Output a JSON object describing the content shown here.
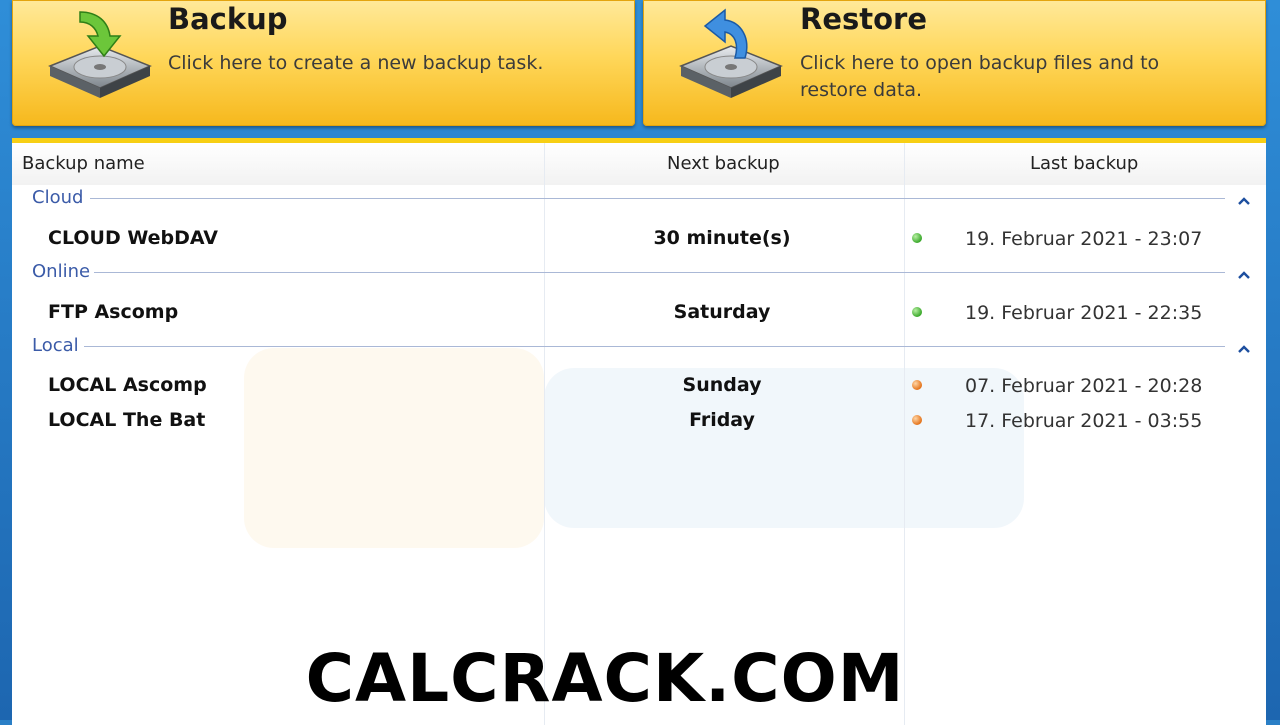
{
  "tiles": {
    "backup": {
      "title": "Backup",
      "desc": "Click here to create a new backup task."
    },
    "restore": {
      "title": "Restore",
      "desc": "Click here to open backup files and to restore data."
    }
  },
  "table": {
    "columns": [
      "Backup name",
      "Next backup",
      "Last backup"
    ],
    "groups": [
      {
        "label": "Cloud",
        "rows": [
          {
            "name": "CLOUD WebDAV",
            "next": "30 minute(s)",
            "last": "19. Februar 2021 - 23:07",
            "status": "green"
          }
        ]
      },
      {
        "label": "Online",
        "rows": [
          {
            "name": "FTP Ascomp",
            "next": "Saturday",
            "last": "19. Februar 2021 - 22:35",
            "status": "green"
          }
        ]
      },
      {
        "label": "Local",
        "rows": [
          {
            "name": "LOCAL Ascomp",
            "next": "Sunday",
            "last": "07. Februar 2021 - 20:28",
            "status": "orange"
          },
          {
            "name": "LOCAL The Bat",
            "next": "Friday",
            "last": "17. Februar 2021 - 03:55",
            "status": "orange"
          }
        ]
      }
    ]
  },
  "watermark": "CALCRACK.COM",
  "colors": {
    "tile": "#ffd75a",
    "accent": "#f7cf15",
    "group": "#3b5ba8",
    "ok": "#3aa82a",
    "warn": "#e4731a"
  },
  "icons": {
    "backup": "disk-arrow-down-icon",
    "restore": "disk-arrow-back-icon",
    "collapse": "chevron-up-icon"
  }
}
